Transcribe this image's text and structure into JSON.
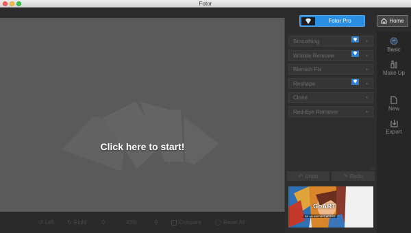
{
  "window": {
    "title": "Fotor"
  },
  "header": {
    "pro_label": "Fotor Pro",
    "home_label": "Home"
  },
  "canvas": {
    "prompt": "Click here to start!"
  },
  "tools": [
    {
      "label": "Smoothing",
      "pro": true
    },
    {
      "label": "Wrinkle Remover",
      "pro": true
    },
    {
      "label": "Blemish Fix",
      "pro": false
    },
    {
      "label": "Reshape",
      "pro": true
    },
    {
      "label": "Clone",
      "pro": false
    },
    {
      "label": "Red-Eye Remover",
      "pro": false
    }
  ],
  "history": {
    "undo_label": "Undo",
    "redo_label": "Redo"
  },
  "nav": [
    {
      "label": "Basic",
      "icon": "basic-icon"
    },
    {
      "label": "Make Up",
      "icon": "makeup-icon"
    },
    {
      "label": "New",
      "icon": "new-file-icon"
    },
    {
      "label": "Export",
      "icon": "export-icon"
    }
  ],
  "bottom_toolbar": {
    "left_label": "Left",
    "right_label": "Right",
    "zoom": "43%",
    "compare_label": "Compare",
    "reset_label": "Reset All"
  },
  "ad": {
    "title": "GoART",
    "subtitle": "BE AN INSTANT ARTIST"
  },
  "colors": {
    "accent": "#2a8fe3",
    "canvas": "#5a5a5a",
    "panel": "#2e2e2e"
  }
}
